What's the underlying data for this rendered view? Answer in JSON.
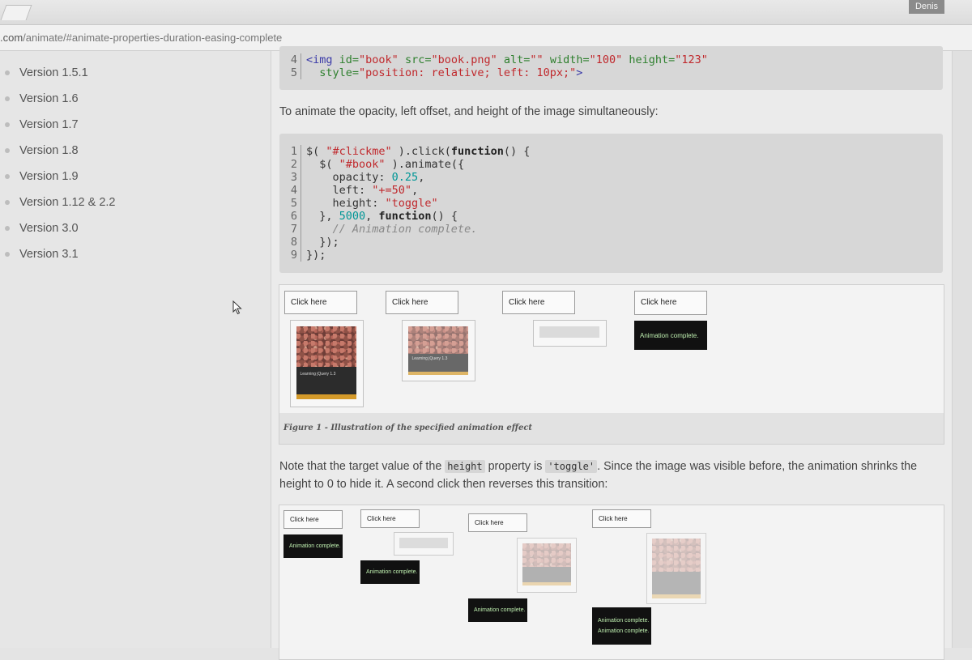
{
  "browser": {
    "user_badge": "Denis",
    "url_domain": ".com",
    "url_path": "/animate/#animate-properties-duration-easing-complete"
  },
  "sidebar": {
    "items": [
      {
        "label": "Version 1.5.1"
      },
      {
        "label": "Version 1.6"
      },
      {
        "label": "Version 1.7"
      },
      {
        "label": "Version 1.8"
      },
      {
        "label": "Version 1.9"
      },
      {
        "label": "Version 1.12 & 2.2"
      },
      {
        "label": "Version 3.0"
      },
      {
        "label": "Version 3.1"
      }
    ]
  },
  "content": {
    "code1": {
      "line_numbers": [
        "4",
        "5"
      ]
    },
    "intro_text": "To animate the opacity, left offset, and height of the image simultaneously:",
    "code2": {
      "line_numbers": [
        "1",
        "2",
        "3",
        "4",
        "5",
        "6",
        "7",
        "8",
        "9"
      ]
    },
    "figure1": {
      "button_label": "Click here",
      "book_title": "Learning jQuery 1.3",
      "complete_label": "Animation complete.",
      "caption": "Figure 1 - Illustration of the specified animation effect"
    },
    "note": {
      "before_height": "Note that the target value of the ",
      "height_code": "height",
      "middle": " property is ",
      "toggle_code": "'toggle'",
      "after": ". Since the image was visible before, the animation shrinks the height to 0 to hide it. A second click then reverses this transition:"
    },
    "figure2": {
      "button_label": "Click here",
      "complete_label": "Animation complete."
    }
  }
}
